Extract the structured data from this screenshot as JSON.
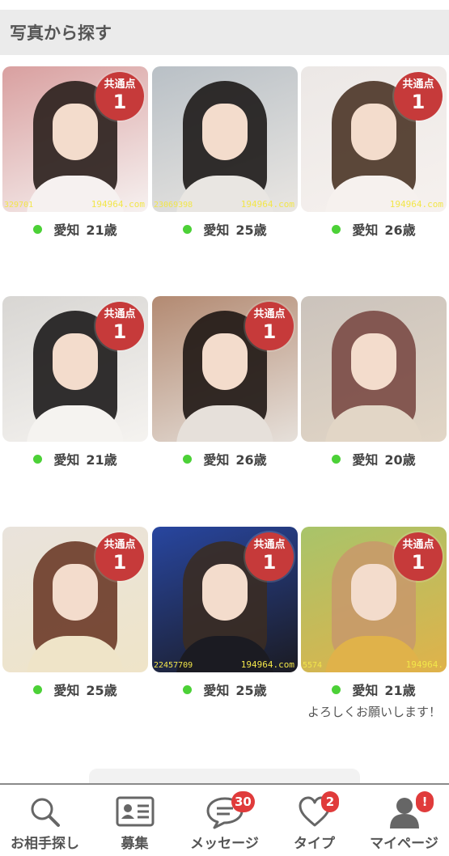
{
  "header": {
    "title": "写真から探す"
  },
  "profiles": [
    {
      "region": "愛知",
      "age": "21歳",
      "badge_label": "共通点",
      "badge_count": "1",
      "watermark": "194964.com",
      "watermark_left": "329701",
      "colors": [
        "#d9a0a0",
        "#2a1f1c",
        "#f6f1f0"
      ]
    },
    {
      "region": "愛知",
      "age": "25歳",
      "badge_label": "",
      "badge_count": "",
      "watermark": "194964.com",
      "watermark_left": "23069398",
      "colors": [
        "#b9c0c6",
        "#1d1a18",
        "#e9e6e2"
      ]
    },
    {
      "region": "愛知",
      "age": "26歳",
      "badge_label": "共通点",
      "badge_count": "1",
      "watermark": "194964.com",
      "watermark_left": "",
      "colors": [
        "#ece8e6",
        "#4a3426",
        "#f6f1ee"
      ]
    },
    {
      "region": "愛知",
      "age": "21歳",
      "badge_label": "共通点",
      "badge_count": "1",
      "watermark": "",
      "watermark_left": "",
      "colors": [
        "#d8d6d3",
        "#1c1a1a",
        "#f5f3f0"
      ]
    },
    {
      "region": "愛知",
      "age": "26歳",
      "badge_label": "共通点",
      "badge_count": "1",
      "watermark": "",
      "watermark_left": "",
      "colors": [
        "#b38a72",
        "#1f1714",
        "#e6e0da"
      ]
    },
    {
      "region": "愛知",
      "age": "20歳",
      "badge_label": "",
      "badge_count": "",
      "watermark": "",
      "watermark_left": "",
      "colors": [
        "#cbc3bc",
        "#7a4a45",
        "#e2d6c6"
      ]
    },
    {
      "region": "愛知",
      "age": "25歳",
      "badge_label": "共通点",
      "badge_count": "1",
      "watermark": "",
      "watermark_left": "",
      "colors": [
        "#e9e3dc",
        "#6b3a28",
        "#efe4c8"
      ]
    },
    {
      "region": "愛知",
      "age": "25歳",
      "badge_label": "共通点",
      "badge_count": "1",
      "watermark": "194964.com",
      "watermark_left": "22457709",
      "colors": [
        "#2846a0",
        "#3a2c24",
        "#1b1b22"
      ]
    },
    {
      "region": "愛知",
      "age": "21歳",
      "badge_label": "共通点",
      "badge_count": "1",
      "watermark": "194964.",
      "watermark_left": "5574",
      "colors": [
        "#a8c46a",
        "#c89a6a",
        "#e0b24a"
      ],
      "message": "よろしくお願いします！"
    }
  ],
  "tabs": [
    {
      "label": "お相手探し",
      "icon": "search-icon",
      "notification": ""
    },
    {
      "label": "募集",
      "icon": "id-card-icon",
      "notification": ""
    },
    {
      "label": "メッセージ",
      "icon": "chat-bubble-icon",
      "notification": "30"
    },
    {
      "label": "タイプ",
      "icon": "heart-icon",
      "notification": "2"
    },
    {
      "label": "マイページ",
      "icon": "person-icon",
      "notification": "!"
    }
  ],
  "colors": {
    "online": "#4cd137",
    "badge": "#c63a3a",
    "notification": "#e03b3b"
  }
}
